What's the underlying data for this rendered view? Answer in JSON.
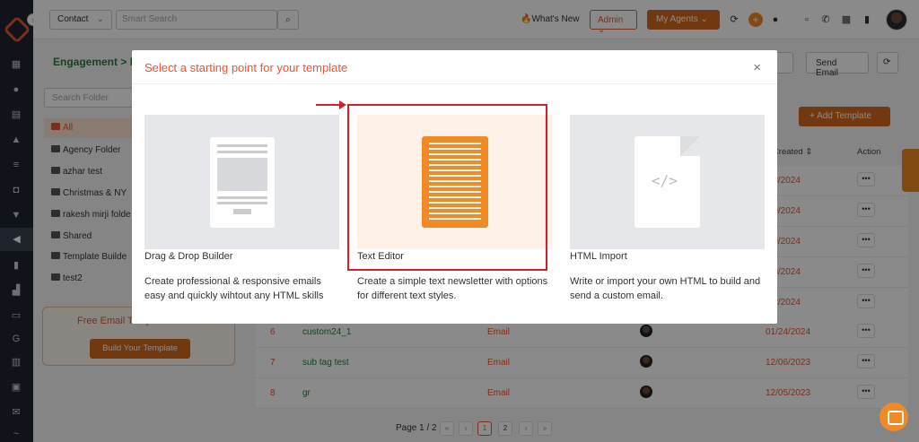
{
  "topbar": {
    "contact_select": "Contact",
    "search_placeholder": "Smart Search",
    "whats_new": "What's New",
    "admin": "Admin",
    "my_agents": "My Agents"
  },
  "page": {
    "breadcrumb": "Engagement  >  E",
    "btn_text": "xt",
    "btn_send_email": "Send Email",
    "folder_search_placeholder": "Search Folder",
    "folders": [
      "All",
      "Agency Folder",
      "azhar test",
      "Christmas & NY",
      "rakesh mirji folde",
      "Shared",
      "Template Builde",
      "test2"
    ],
    "promo_title": "Free Email Templ...",
    "promo_button": "Build Your Template",
    "add_template": "+  Add Template",
    "col_date_created": "e Created ⇕",
    "col_action": "Action",
    "rows": [
      {
        "num": "",
        "name": "",
        "type": "",
        "date": "/23/2024"
      },
      {
        "num": "",
        "name": "",
        "type": "",
        "date": "/09/2024"
      },
      {
        "num": "",
        "name": "",
        "type": "",
        "date": "/09/2024"
      },
      {
        "num": "",
        "name": "",
        "type": "",
        "date": "/03/2024"
      },
      {
        "num": "",
        "name": "",
        "type": "",
        "date": "/02/2024"
      },
      {
        "num": "6",
        "name": "custom24_1",
        "type": "Email",
        "date": "01/24/2024"
      },
      {
        "num": "7",
        "name": "sub tag test",
        "type": "Email",
        "date": "12/06/2023"
      },
      {
        "num": "8",
        "name": "gr",
        "type": "Email",
        "date": "12/05/2023"
      }
    ],
    "pager": "Page 1 / 2",
    "pages": [
      "1",
      "2"
    ]
  },
  "modal": {
    "title": "Select a starting point for your template",
    "cards": [
      {
        "label": "Drag & Drop Builder",
        "desc": "Create professional & responsive emails easy and quickly wihtout any HTML skills"
      },
      {
        "label": "Text Editor",
        "desc": "Create a simple text newsletter with options for different text styles."
      },
      {
        "label": "HTML Import",
        "desc": "Write or import your own HTML to build and send a custom email."
      }
    ]
  },
  "colors": {
    "accent": "#e8552f",
    "brand_orange": "#f08a24",
    "annotation_red": "#d21f2a",
    "sidebar_bg": "#1f2430"
  }
}
